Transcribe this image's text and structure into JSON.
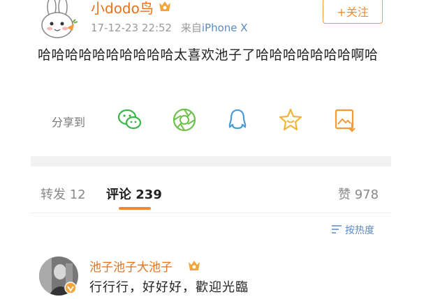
{
  "post": {
    "username": "小dodo鸟",
    "timestamp": "17-12-23 22:52",
    "source_prefix": "来自",
    "source": "iPhone X",
    "follow_label": "+关注",
    "text": "哈哈哈哈哈哈哈哈哈哈太喜欢池子了哈哈哈哈哈哈哈啊哈"
  },
  "share": {
    "label": "分享到",
    "icons": [
      "wechat-icon",
      "moments-icon",
      "qq-icon",
      "favorite-icon",
      "save-image-icon"
    ]
  },
  "tabs": {
    "repost_label": "转发",
    "repost_count": "12",
    "comment_label": "评论",
    "comment_count": "239",
    "like_label": "赞",
    "like_count": "978"
  },
  "sort_label": "按热度",
  "comment": {
    "username": "池子池子大池子",
    "text": "行行行，好好好，歡迎光臨"
  },
  "colors": {
    "accent": "#f08a2d",
    "link": "#5b8bc2"
  }
}
